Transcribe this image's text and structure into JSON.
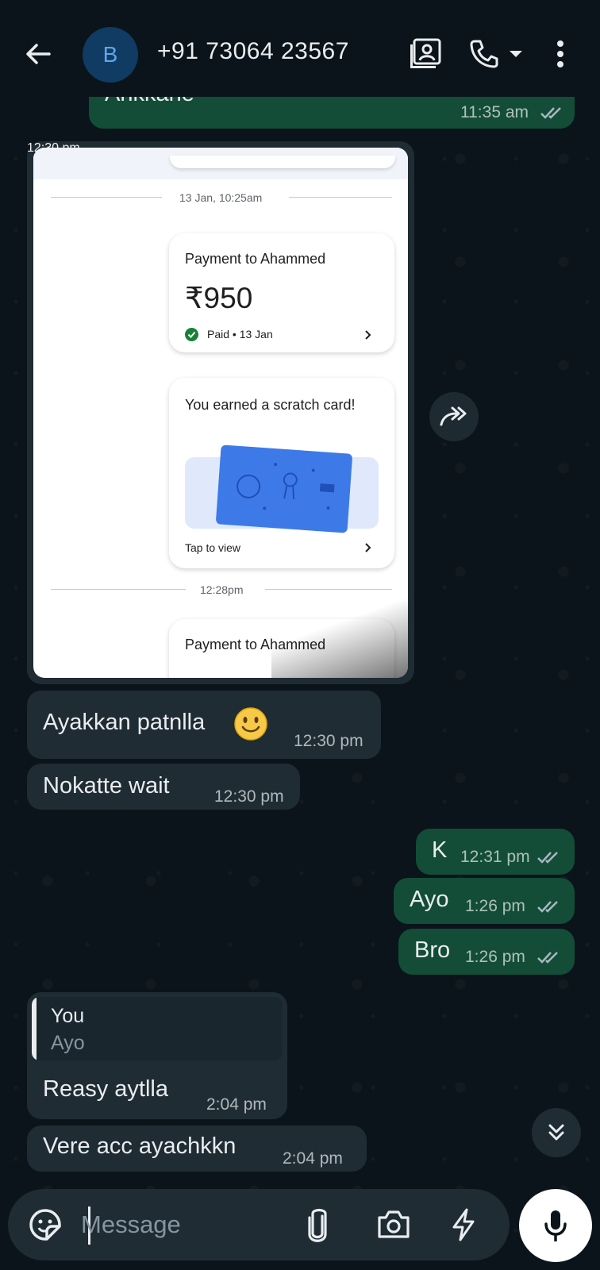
{
  "header": {
    "avatar_letter": "B",
    "contact": "+91 73064 23567"
  },
  "messages": [
    {
      "id": "m0",
      "dir": "out",
      "text": "Ahkkahe",
      "time": "11:35 am",
      "read": true
    },
    {
      "id": "m1",
      "dir": "in",
      "type": "image",
      "time": "12:30 pm",
      "image": {
        "timestamp1": "13 Jan, 10:25am",
        "payment_title": "Payment to Ahammed",
        "amount": "₹950",
        "status": "Paid • 13 Jan",
        "scratch_title": "You earned a scratch card!",
        "tap_label": "Tap to view",
        "timestamp2": "12:28pm",
        "payment_title2": "Payment to Ahammed"
      }
    },
    {
      "id": "m2",
      "dir": "in",
      "text": "Ayakkan patnlla",
      "time": "12:30 pm"
    },
    {
      "id": "m3",
      "dir": "in",
      "text": "Nokatte wait",
      "time": "12:30 pm"
    },
    {
      "id": "m4",
      "dir": "out",
      "text": "K",
      "time": "12:31 pm",
      "read": true
    },
    {
      "id": "m5",
      "dir": "out",
      "text": "Ayo",
      "time": "1:26 pm",
      "read": true
    },
    {
      "id": "m6",
      "dir": "out",
      "text": "Bro",
      "time": "1:26 pm",
      "read": true
    },
    {
      "id": "m7",
      "dir": "in",
      "text": "Reasy aytlla",
      "time": "2:04 pm",
      "reply": {
        "author": "You",
        "text": "Ayo"
      }
    },
    {
      "id": "m8",
      "dir": "in",
      "text": "Vere acc ayachkkn",
      "time": "2:04 pm"
    }
  ],
  "composer": {
    "placeholder": "Message"
  },
  "colors": {
    "background": "#0b141a",
    "incoming_bubble": "#1f2c34",
    "outgoing_bubble": "#134d37",
    "tick_blue": "#a8b8c0"
  }
}
